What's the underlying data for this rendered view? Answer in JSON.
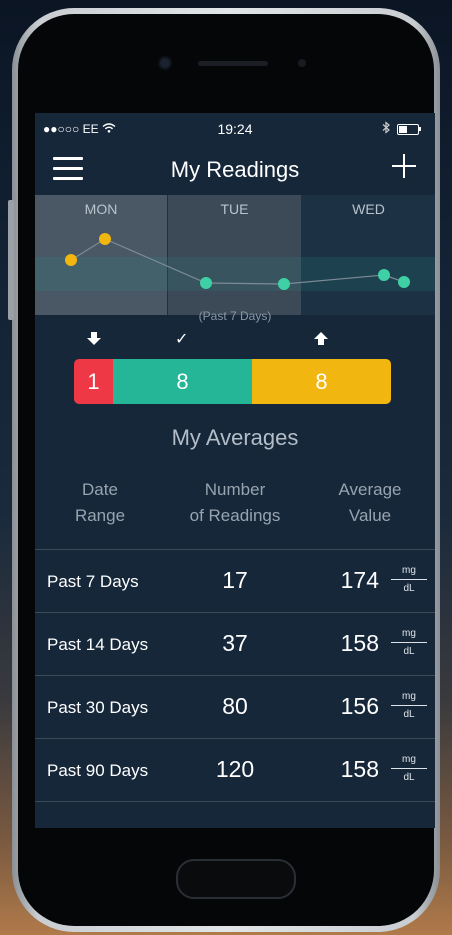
{
  "status_bar": {
    "carrier": "●●○○○ EE ",
    "wifi_icon": "wifi-icon",
    "time": "19:24",
    "bluetooth_icon": "bluetooth-icon",
    "battery_level": 0.45
  },
  "nav": {
    "title": "My Readings",
    "menu_icon": "hamburger-menu-icon",
    "add_icon": "plus-icon"
  },
  "day_chart": {
    "days": [
      "MON",
      "TUE",
      "WED"
    ],
    "caption": "(Past 7 Days)",
    "point_colors": {
      "high": "#f1b60f",
      "normal": "#3fd0a6"
    }
  },
  "range_icons": {
    "low": "arrow-down-icon",
    "normal": "check-icon",
    "high": "arrow-up-icon"
  },
  "distribution": {
    "low": "1",
    "normal": "8",
    "high": "8",
    "colors": {
      "low": "#ee3846",
      "normal": "#25b597",
      "high": "#f1b60f"
    }
  },
  "averages": {
    "title": "My Averages",
    "headers": {
      "date_range_1": "Date",
      "date_range_2": "Range",
      "readings_1": "Number",
      "readings_2": "of Readings",
      "value_1": "Average",
      "value_2": "Value"
    },
    "unit_numerator": "mg",
    "unit_denominator": "dL",
    "rows": [
      {
        "label": "Past 7 Days",
        "count": "17",
        "avg": "174"
      },
      {
        "label": "Past 14 Days",
        "count": "37",
        "avg": "158"
      },
      {
        "label": "Past 30 Days",
        "count": "80",
        "avg": "156"
      },
      {
        "label": "Past 90 Days",
        "count": "120",
        "avg": "158"
      }
    ]
  }
}
